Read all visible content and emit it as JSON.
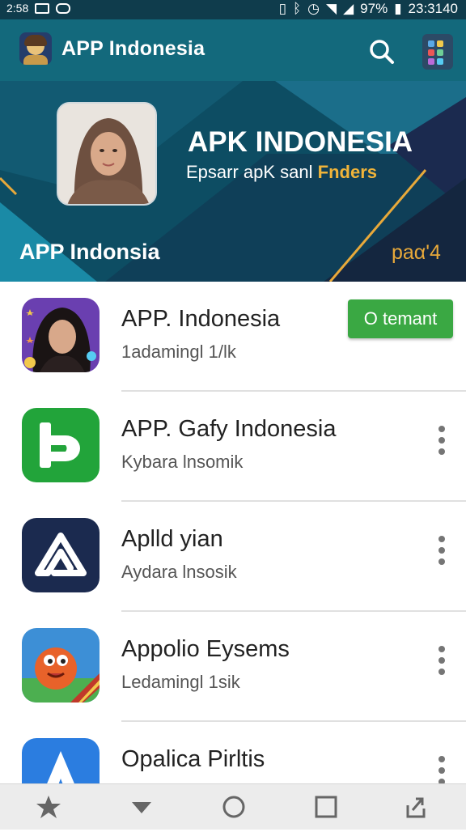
{
  "status_bar": {
    "left_text": "2:58",
    "battery": "97%",
    "time": "23:3140",
    "icons": [
      "image-icon",
      "cast-icon",
      "vibrate-icon",
      "bluetooth-icon",
      "alarm-icon",
      "wifi-icon",
      "signal-icon",
      "battery-icon"
    ]
  },
  "app_bar": {
    "title": "APP Indonesia",
    "icons": [
      "app-logo-icon",
      "search-icon",
      "apps-grid-icon"
    ]
  },
  "banner": {
    "title": "APK INDONESIA",
    "subtitle_start": "Epsarr apK sanl ",
    "subtitle_highlight": "Fnders",
    "bottom_label": "APP Indonsia",
    "page_label": "paα'4",
    "colors": {
      "teal": "#0d4d63",
      "gold": "#e8a93a",
      "dark_blue": "#1b2a4f"
    }
  },
  "apps": [
    {
      "name": "APP. Indonesia",
      "subtitle": "1adamingl 1/lk",
      "action": "O temant",
      "icon": "woman-portrait-icon"
    },
    {
      "name": "APP. Gafy Indonesia",
      "subtitle": "Kybara lnsomik",
      "icon": "green-b-logo-icon"
    },
    {
      "name": "Aplld yian",
      "subtitle": "Aydara lnsosik",
      "icon": "triangle-logo-icon"
    },
    {
      "name": "Appolio Eysems",
      "subtitle": "Ledamingl 1sik",
      "icon": "cartoon-mascot-icon"
    },
    {
      "name": "Opalica Pirltis",
      "subtitle": "",
      "icon": "blue-a-logo-icon"
    }
  ],
  "bottom_nav": {
    "items": [
      "star-icon",
      "back-triangle-icon",
      "home-circle-icon",
      "recents-square-icon",
      "share-icon"
    ]
  },
  "accent_colors": {
    "install_green": "#3aa843",
    "appbar_teal": "#13697c",
    "status_bar": "#0f3c4c"
  }
}
